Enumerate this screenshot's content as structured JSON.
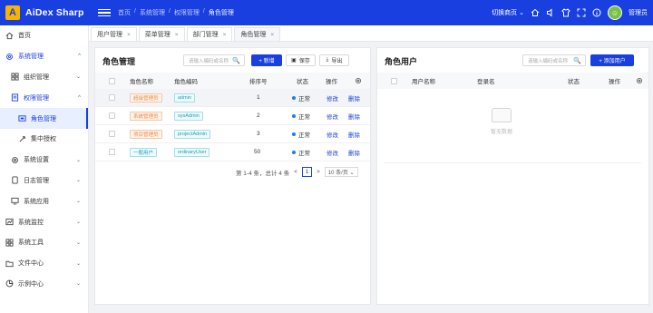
{
  "app": {
    "name": "AiDex Sharp",
    "logo_letter": "A",
    "brand_color": "#1a3fe0"
  },
  "breadcrumb": [
    "首页",
    "系统管理",
    "权限管理",
    "角色管理"
  ],
  "topbar": {
    "switch_label": "切换商页 ⌄",
    "user_label": "管理员",
    "icons": [
      "home-icon",
      "volume-icon",
      "shirt-icon",
      "fullscreen-icon",
      "info-icon"
    ]
  },
  "sidebar": {
    "items": [
      {
        "label": "首页",
        "icon": "home-icon"
      },
      {
        "label": "系统管理",
        "icon": "gear-icon",
        "arrow": "^"
      },
      {
        "label": "组织管理",
        "icon": "grid-icon",
        "arrow": "⌄"
      },
      {
        "label": "权限管理",
        "icon": "doc-icon",
        "arrow": "^"
      },
      {
        "label": "角色管理",
        "icon": "role-icon"
      },
      {
        "label": "集中授权",
        "icon": "link-icon"
      },
      {
        "label": "系统设置",
        "icon": "settings-icon",
        "arrow": "⌄"
      },
      {
        "label": "日志管理",
        "icon": "log-icon",
        "arrow": "⌄"
      },
      {
        "label": "系统应用",
        "icon": "monitor-icon",
        "arrow": "⌄"
      },
      {
        "label": "系统监控",
        "icon": "chart-icon",
        "arrow": "⌄"
      },
      {
        "label": "系统工具",
        "icon": "tools-icon",
        "arrow": "⌄"
      },
      {
        "label": "文件中心",
        "icon": "folder-icon",
        "arrow": "⌄"
      },
      {
        "label": "示例中心",
        "icon": "pie-icon",
        "arrow": "⌄"
      }
    ]
  },
  "tabs": [
    {
      "label": "用户管理",
      "close": "×"
    },
    {
      "label": "菜单管理",
      "close": "×"
    },
    {
      "label": "部门管理",
      "close": "×"
    },
    {
      "label": "角色管理",
      "close": "×"
    }
  ],
  "role_panel": {
    "title": "角色管理",
    "search_placeholder": "请输入编码或名称",
    "search_icon": "🔍",
    "add_label": "+ 新增",
    "save_label": "保存",
    "export_label": "导出",
    "columns": [
      "角色名称",
      "角色编码",
      "排序号",
      "状态",
      "操作"
    ],
    "rows": [
      {
        "name": "超级管理员",
        "code": "admin",
        "order": "1",
        "status": "正常",
        "edit": "修改",
        "del": "删除",
        "tag": "o"
      },
      {
        "name": "系统管理员",
        "code": "sysAdmin",
        "order": "2",
        "status": "正常",
        "edit": "修改",
        "del": "删除",
        "tag": "o"
      },
      {
        "name": "项目管理员",
        "code": "projectAdmin",
        "order": "3",
        "status": "正常",
        "edit": "修改",
        "del": "删除",
        "tag": "o"
      },
      {
        "name": "一般用户",
        "code": "ordinaryUser",
        "order": "50",
        "status": "正常",
        "edit": "修改",
        "del": "删除",
        "tag": "b"
      }
    ],
    "pager": {
      "summary": "第 1-4 条，总计 4 条",
      "prev": "<",
      "page": "1",
      "next": ">",
      "size": "10 条/页 ⌄"
    }
  },
  "user_panel": {
    "title": "角色用户",
    "search_placeholder": "请输入编码或名称",
    "search_icon": "🔍",
    "add_label": "+ 添加用户",
    "columns": [
      "用户名称",
      "登录名",
      "状态",
      "操作"
    ],
    "empty_text": "暂无数据"
  }
}
